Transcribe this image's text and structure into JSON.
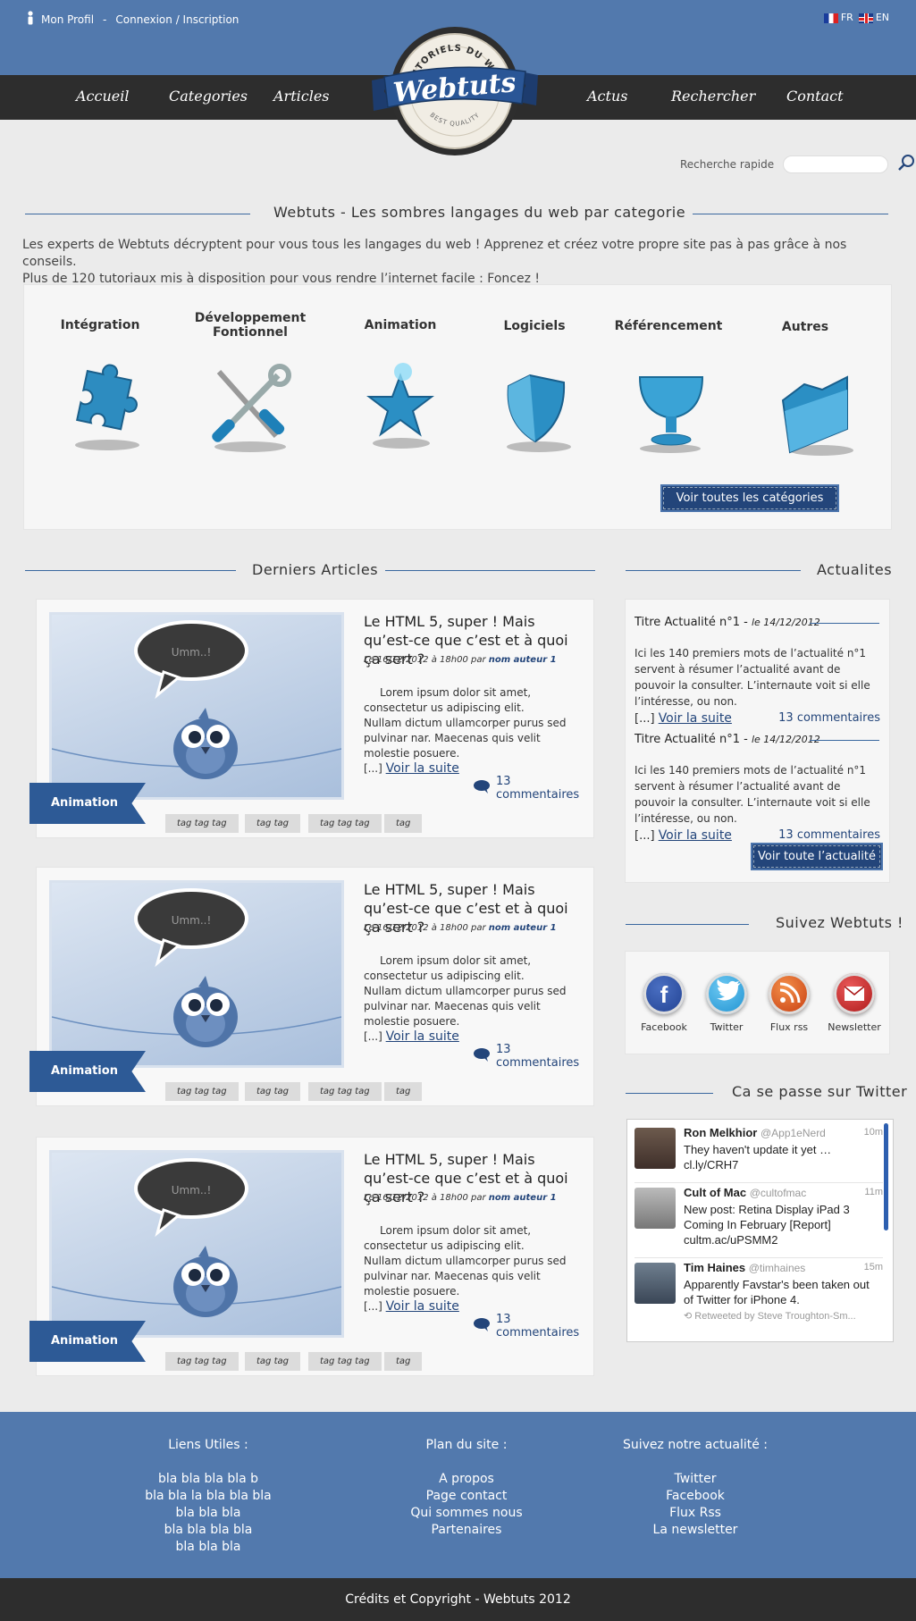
{
  "topbar": {
    "profile": "Mon Profil",
    "separator": "-",
    "login": "Connexion / Inscription",
    "lang_fr": "FR",
    "lang_en": "EN"
  },
  "nav": {
    "items": [
      "Accueil",
      "Categories",
      "Articles",
      "Actus",
      "Rechercher",
      "Contact"
    ]
  },
  "logo": {
    "arc_text": "TUTORIELS DU WEB",
    "name": "Webtuts",
    "bottom_text": "BEST QUALITY"
  },
  "search": {
    "label": "Recherche rapide",
    "placeholder": ""
  },
  "section_main": {
    "title": "Webtuts - Les sombres langages du web par categorie"
  },
  "intro": {
    "line1": "Les experts de Webtuts décryptent pour vous tous les langages du web ! Apprenez et créez votre propre site pas à pas grâce à nos conseils.",
    "line2": "Plus  de 120 tutoriaux mis à disposition pour vous rendre l’internet facile  : Foncez !"
  },
  "categories": {
    "items": [
      {
        "label": "Intégration",
        "icon": "puzzle-icon"
      },
      {
        "label": "Développement Fontionnel",
        "icon": "tools-icon"
      },
      {
        "label": "Animation",
        "icon": "star-icon"
      },
      {
        "label": "Logiciels",
        "icon": "shield-icon"
      },
      {
        "label": "Référencement",
        "icon": "trophy-icon"
      },
      {
        "label": "Autres",
        "icon": "folder-icon"
      }
    ],
    "button": "Voir toutes les catégories"
  },
  "articles": {
    "title": "Derniers Articles",
    "items": [
      {
        "title": "Le HTML 5, super ! Mais qu’est-ce que c’est et à quoi ça sert ?",
        "meta_prefix": "Le 16/12/2012 à 18h00 par ",
        "author": "nom auteur 1",
        "body": "Lorem ipsum dolor sit amet, consectetur us adipiscing elit.",
        "body2": "Nullam dictum ullamcorper purus sed pulvinar nar. Maecenas quis velit molestie posuere.",
        "ellipsis": "[...] ",
        "more": "Voir la suite",
        "comments": "13 commentaires",
        "category": "Animation",
        "bubble": "Umm..!",
        "tags": [
          "tag tag tag",
          "tag tag",
          "tag tag tag",
          "tag"
        ]
      },
      {
        "title": "Le HTML 5, super ! Mais qu’est-ce que c’est et à quoi ça sert ?",
        "meta_prefix": "Le 16/12/2012 à 18h00 par ",
        "author": "nom auteur 1",
        "body": "Lorem ipsum dolor sit amet, consectetur us adipiscing elit.",
        "body2": "Nullam dictum ullamcorper purus sed pulvinar nar. Maecenas quis velit molestie posuere.",
        "ellipsis": "[...] ",
        "more": "Voir la suite",
        "comments": "13 commentaires",
        "category": "Animation",
        "bubble": "Umm..!",
        "tags": [
          "tag tag tag",
          "tag tag",
          "tag tag tag",
          "tag"
        ]
      },
      {
        "title": "Le HTML 5, super ! Mais qu’est-ce que c’est et à quoi ça sert ?",
        "meta_prefix": "Le 16/12/2012 à 18h00 par ",
        "author": "nom auteur 1",
        "body": "Lorem ipsum dolor sit amet, consectetur us adipiscing elit.",
        "body2": "Nullam dictum ullamcorper purus sed pulvinar nar. Maecenas quis velit molestie posuere.",
        "ellipsis": "[...] ",
        "more": "Voir la suite",
        "comments": "13 commentaires",
        "category": "Animation",
        "bubble": "Umm..!",
        "tags": [
          "tag tag tag",
          "tag tag",
          "tag tag tag",
          "tag"
        ]
      }
    ]
  },
  "news": {
    "title": "Actualites",
    "items": [
      {
        "title": "Titre Actualité n°1 - ",
        "date": "le 14/12/2012",
        "body": "Ici les 140 premiers mots de l’actualité n°1 servent à résumer l’actualité avant de pouvoir la consulter. L’internaute voit si elle l’intéresse, ou non.",
        "ellipsis": "[...] ",
        "more": "Voir la suite",
        "comments": "13 commentaires"
      },
      {
        "title": "Titre Actualité n°1 - ",
        "date": "le 14/12/2012",
        "body": "Ici les 140 premiers mots de l’actualité n°1 servent à résumer l’actualité avant de pouvoir la consulter. L’internaute voit si elle l’intéresse, ou non.",
        "ellipsis": "[...] ",
        "more": "Voir la suite",
        "comments": "13 commentaires"
      }
    ],
    "button": "Voir toute l’actualité"
  },
  "follow": {
    "title": "Suivez Webtuts !",
    "items": [
      {
        "label": "Facebook",
        "icon": "facebook-icon",
        "color": "#1f3f8f"
      },
      {
        "label": "Twitter",
        "icon": "twitter-icon",
        "color": "#2aa2e0"
      },
      {
        "label": "Flux rss",
        "icon": "rss-icon",
        "color": "#e0501a"
      },
      {
        "label": "Newsletter",
        "icon": "newsletter-icon",
        "color": "#c21a1a"
      }
    ]
  },
  "twitter": {
    "title": "Ca se passe sur Twitter",
    "tweets": [
      {
        "name": "Ron Melkhior",
        "handle": "@App1eNerd",
        "time": "10m",
        "text": "They haven't update it yet …",
        "text2": "cl.ly/CRH7"
      },
      {
        "name": "Cult of Mac",
        "handle": "@cultofmac",
        "time": "11m",
        "text": "New post: Retina Display iPad 3 Coming In February [Report]",
        "text2": "cultm.ac/uPSMM2"
      },
      {
        "name": "Tim Haines",
        "handle": "@timhaines",
        "time": "15m",
        "text": "Apparently Favstar's been taken out of Twitter for iPhone 4.",
        "retweet": "Retweeted by Steve Troughton-Sm..."
      }
    ]
  },
  "footer": {
    "col1": {
      "title": "Liens Utiles  :",
      "links": [
        "bla bla bla bla b",
        "bla bla la bla bla bla",
        "bla bla bla",
        "bla bla bla bla",
        "bla bla bla"
      ]
    },
    "col2": {
      "title": "Plan du site :",
      "links": [
        "A propos",
        "Page contact",
        "Qui sommes nous",
        "Partenaires"
      ]
    },
    "col3": {
      "title": "Suivez notre actualité  :",
      "links": [
        "Twitter",
        "Facebook",
        "Flux Rss",
        "La newsletter"
      ]
    },
    "copyright": "Crédits et Copyright - Webtuts 2012"
  },
  "colors": {
    "accent": "#23457a",
    "header_blue": "#5279ad",
    "dark_bar": "#2d2d2d",
    "background": "#ebebeb"
  }
}
